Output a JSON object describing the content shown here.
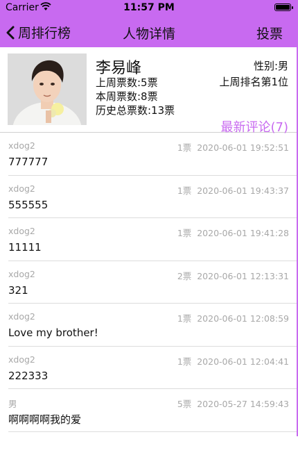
{
  "status_bar": {
    "carrier": "Carrier",
    "time": "11:57 PM"
  },
  "nav": {
    "back_label": "周排行榜",
    "title": "人物详情",
    "vote_label": "投票"
  },
  "person": {
    "name": "李易峰",
    "gender": "性别:男",
    "last_week_votes": "上周票数:5票",
    "this_week_votes": "本周票数:8票",
    "total_votes": "历史总票数:13票",
    "last_week_rank": "上周排名第1位"
  },
  "comments_link": "最新评论(7)",
  "comments": [
    {
      "user": "xdog2",
      "votes": "1票",
      "time": "2020-06-01 19:52:51",
      "text": "777777"
    },
    {
      "user": "xdog2",
      "votes": "1票",
      "time": "2020-06-01 19:43:37",
      "text": "555555"
    },
    {
      "user": "xdog2",
      "votes": "1票",
      "time": "2020-06-01 19:41:28",
      "text": "11111"
    },
    {
      "user": "xdog2",
      "votes": "2票",
      "time": "2020-06-01 12:13:31",
      "text": "321"
    },
    {
      "user": "xdog2",
      "votes": "1票",
      "time": "2020-06-01 12:08:59",
      "text": "Love my brother!"
    },
    {
      "user": "xdog2",
      "votes": "1票",
      "time": "2020-06-01 12:04:41",
      "text": "222333"
    },
    {
      "user": "男",
      "votes": "5票",
      "time": "2020-05-27 14:59:43",
      "text": "啊啊啊啊我的爱"
    }
  ],
  "colors": {
    "accent": "#c86af0",
    "meta_text": "#a8a8a8",
    "separator": "#dcdcdc"
  },
  "icons": {
    "back": "chevron-left-icon",
    "wifi": "wifi-icon",
    "battery": "battery-icon"
  }
}
